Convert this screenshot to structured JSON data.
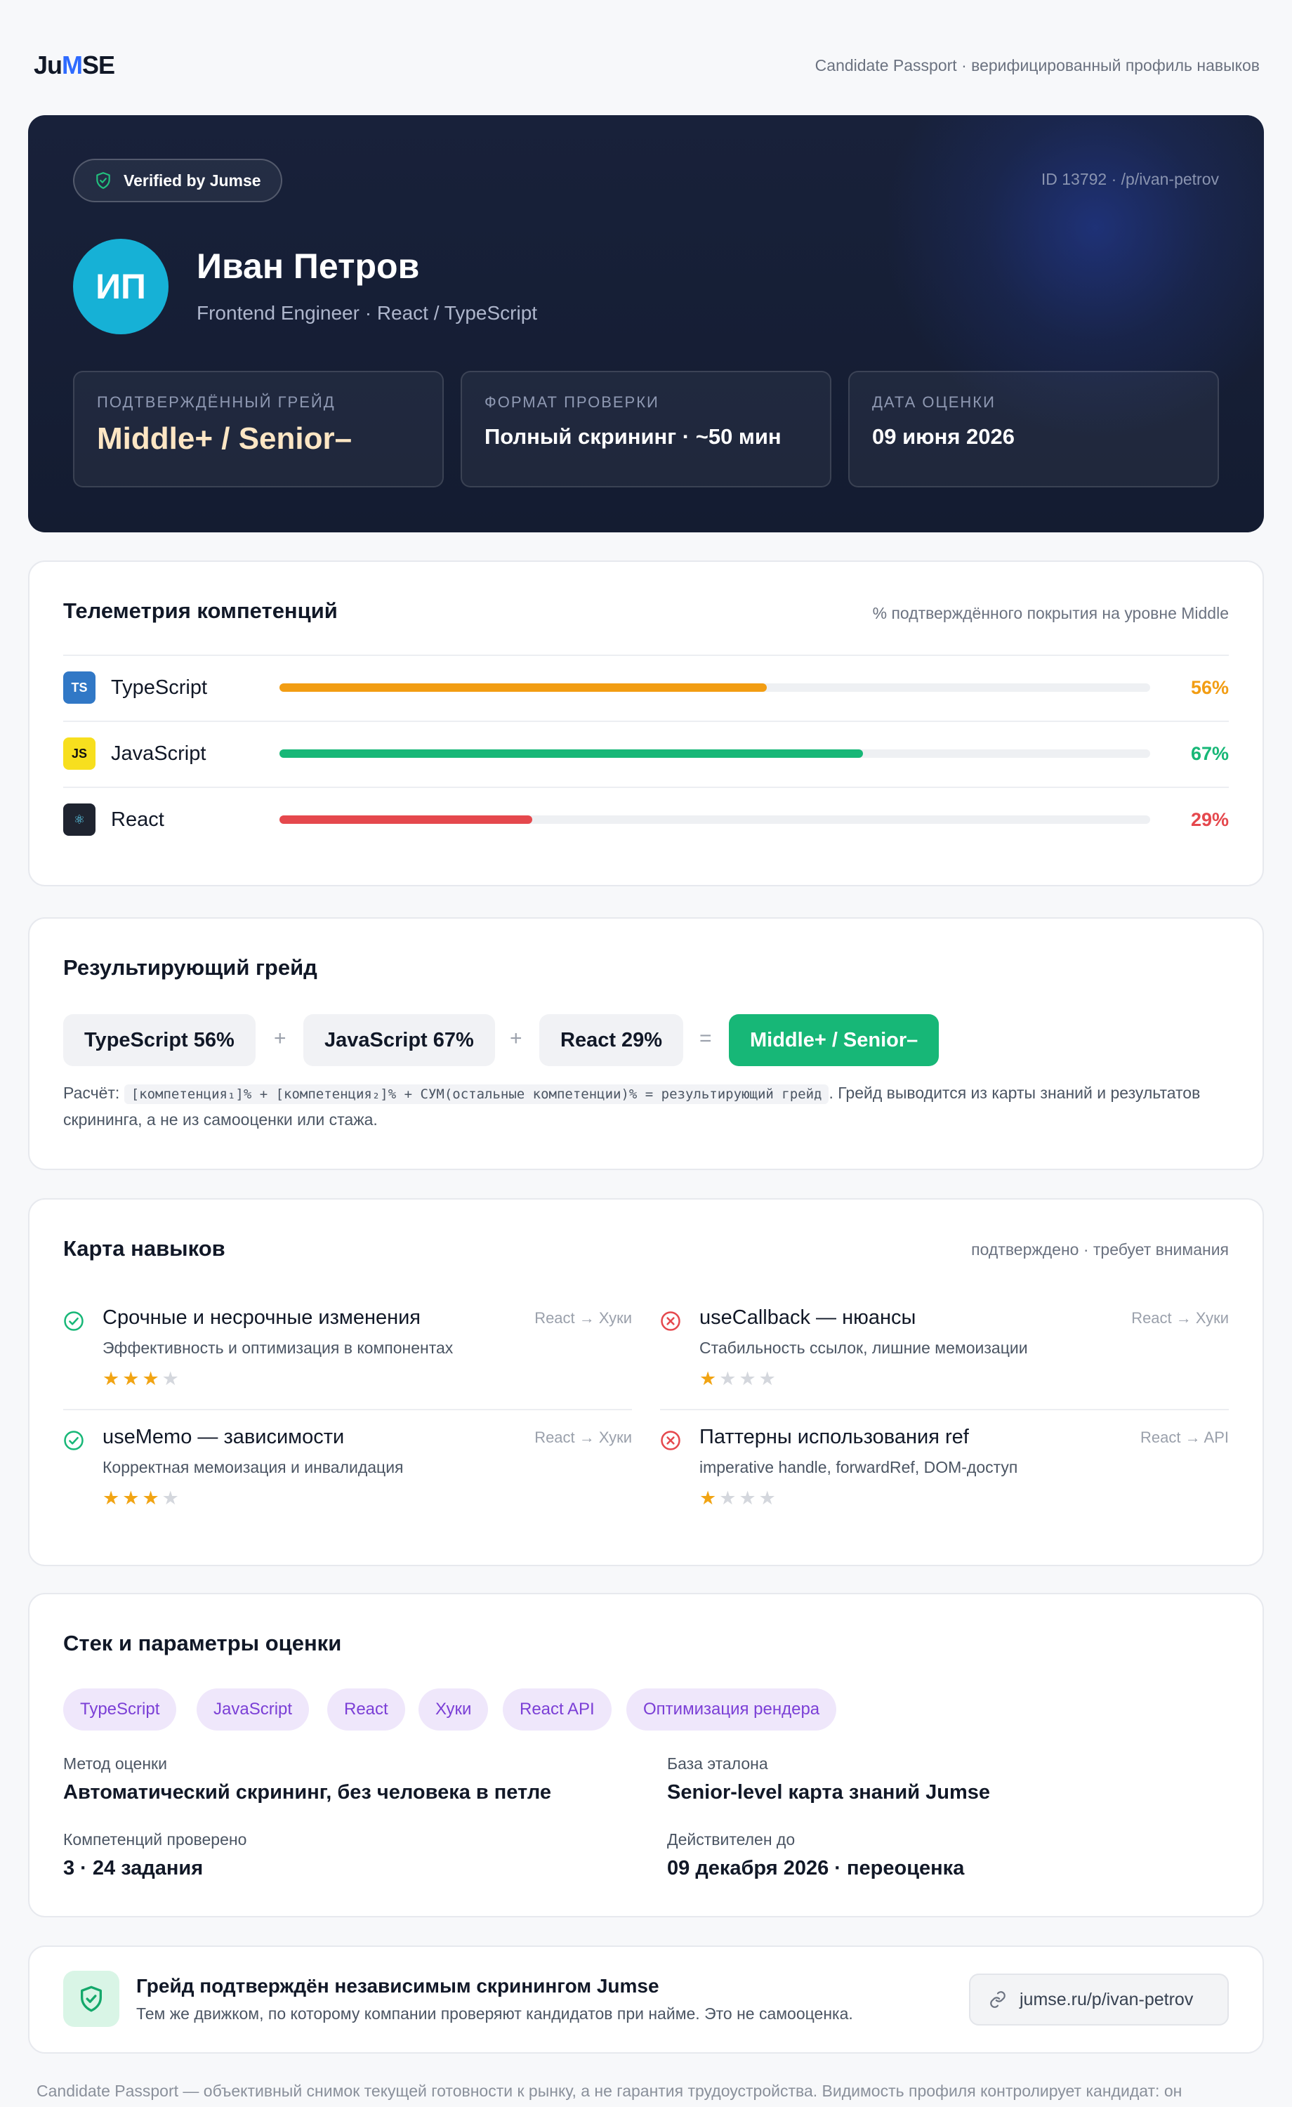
{
  "topbar": {
    "logo_left": "Ju",
    "logo_accent": "M",
    "logo_right": "SE",
    "tagline": "Candidate Passport · верифицированный профиль навыков"
  },
  "hero": {
    "verified_label": "Verified by Jumse",
    "profile_id": "ID 13792 · /p/ivan-petrov",
    "initials": "ИП",
    "name": "Иван Петров",
    "role": "Frontend Engineer · React / TypeScript",
    "stats": [
      {
        "label": "Подтверждённый грейд",
        "value": "Middle+ / Senior–"
      },
      {
        "label": "Формат проверки",
        "value": "Полный скрининг · ~50 мин"
      },
      {
        "label": "Дата оценки",
        "value": "09 июня 2026"
      }
    ]
  },
  "telemetry": {
    "title": "Телеметрия компетенций",
    "note": "% подтверждённого покрытия на уровне Middle",
    "rows": [
      {
        "badge": "TS",
        "name": "TypeScript",
        "percent": 56,
        "percent_label": "56%",
        "color": "#f29d13"
      },
      {
        "badge": "JS",
        "name": "JavaScript",
        "percent": 67,
        "percent_label": "67%",
        "color": "#17b777"
      },
      {
        "badge": "⚛",
        "name": "React",
        "percent": 29,
        "percent_label": "29%",
        "color": "#e5484d"
      }
    ]
  },
  "grade": {
    "title": "Результирующий грейд",
    "chips": [
      "TypeScript 56%",
      "JavaScript 67%",
      "React 29%"
    ],
    "plus": "+",
    "equals": "=",
    "result": "Middle+ / Senior–",
    "calc_prefix": "Расчёт:",
    "calc_formula": "[компетенция₁]% + [компетенция₂]% + СУМ(остальные компетенции)% = результирующий грейд",
    "calc_suffix": ". Грейд выводится из карты знаний и результатов скрининга, а не из самооценки или стажа."
  },
  "skills": {
    "title": "Карта навыков",
    "legend": "подтверждено · требует внимания",
    "items": [
      {
        "title": "Срочные и несрочные изменения",
        "sub": "Эффективность и оптимизация в компонентах",
        "path": "React → Хуки",
        "status": "ok",
        "stars": 3
      },
      {
        "title": "useCallback — нюансы",
        "sub": "Стабильность ссылок, лишние мемоизации",
        "path": "React → Хуки",
        "status": "fail",
        "stars": 1
      },
      {
        "title": "useMemo — зависимости",
        "sub": "Корректная мемоизация и инвалидация",
        "path": "React → Хуки",
        "status": "ok",
        "stars": 3
      },
      {
        "title": "Паттерны использования ref",
        "sub": "imperative handle, forwardRef, DOM-доступ",
        "path": "React → API",
        "status": "fail",
        "stars": 1
      }
    ]
  },
  "stack": {
    "title": "Стек и параметры оценки",
    "tags": [
      "TypeScript",
      "JavaScript",
      "React",
      "Хуки",
      "React API",
      "Оптимизация рендера"
    ],
    "params": [
      {
        "label": "Метод оценки",
        "value": "Автоматический скрининг, без человека в петле"
      },
      {
        "label": "База эталона",
        "value": "Senior-level карта знаний Jumse"
      },
      {
        "label": "Компетенций проверено",
        "value": "3 · 24 задания"
      },
      {
        "label": "Действителен до",
        "value": "09 декабря 2026 · переоценка"
      }
    ]
  },
  "verify": {
    "title": "Грейд подтверждён независимым скринингом Jumse",
    "sub": "Тем же движком, по которому компании проверяют кандидатов при найме. Это не самооценка.",
    "link": "jumse.ru/p/ivan-petrov"
  },
  "footnote": "Candidate Passport — объективный снимок текущей готовности к рынку, а не гарантия трудоустройства. Видимость профиля контролирует кандидат: он",
  "colors": {
    "accent": "#2f6bff",
    "success": "#17b777",
    "danger": "#e5484d",
    "warning": "#f29d13",
    "avatar": "#16b1d6"
  }
}
